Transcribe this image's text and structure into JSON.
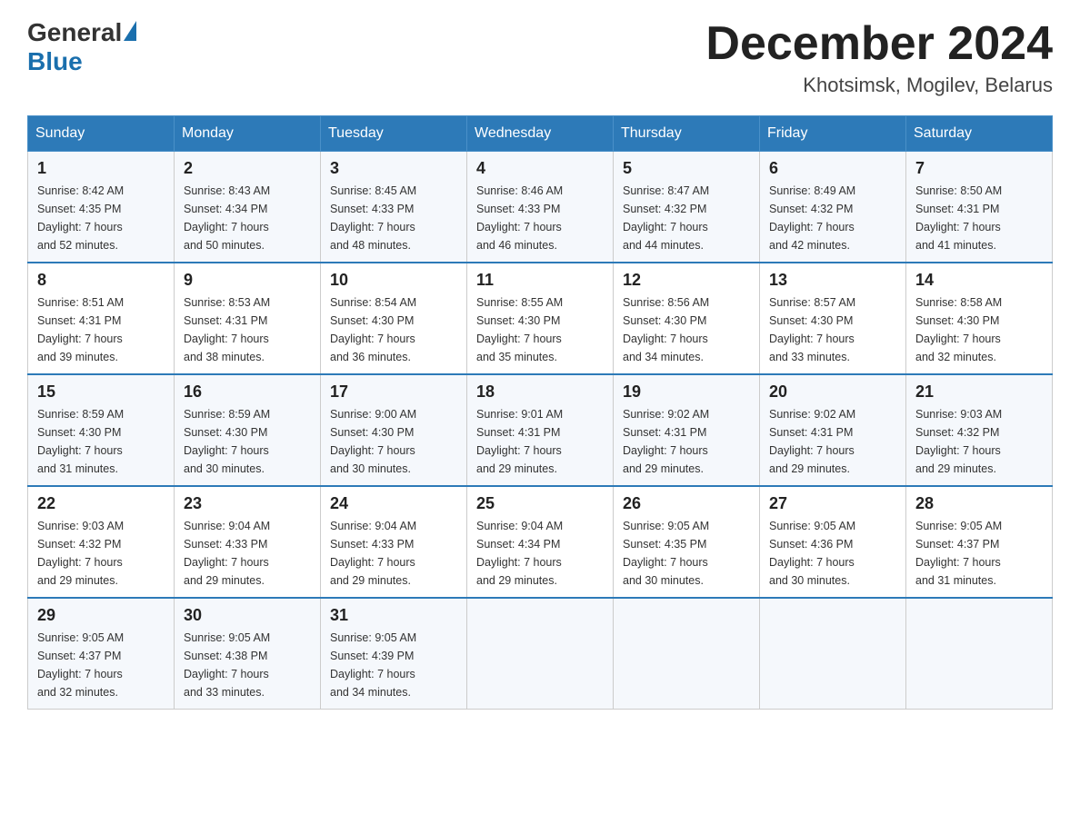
{
  "header": {
    "logo_general": "General",
    "logo_blue": "Blue",
    "month_title": "December 2024",
    "location": "Khotsimsk, Mogilev, Belarus"
  },
  "weekdays": [
    "Sunday",
    "Monday",
    "Tuesday",
    "Wednesday",
    "Thursday",
    "Friday",
    "Saturday"
  ],
  "weeks": [
    [
      {
        "day": "1",
        "info": "Sunrise: 8:42 AM\nSunset: 4:35 PM\nDaylight: 7 hours\nand 52 minutes."
      },
      {
        "day": "2",
        "info": "Sunrise: 8:43 AM\nSunset: 4:34 PM\nDaylight: 7 hours\nand 50 minutes."
      },
      {
        "day": "3",
        "info": "Sunrise: 8:45 AM\nSunset: 4:33 PM\nDaylight: 7 hours\nand 48 minutes."
      },
      {
        "day": "4",
        "info": "Sunrise: 8:46 AM\nSunset: 4:33 PM\nDaylight: 7 hours\nand 46 minutes."
      },
      {
        "day": "5",
        "info": "Sunrise: 8:47 AM\nSunset: 4:32 PM\nDaylight: 7 hours\nand 44 minutes."
      },
      {
        "day": "6",
        "info": "Sunrise: 8:49 AM\nSunset: 4:32 PM\nDaylight: 7 hours\nand 42 minutes."
      },
      {
        "day": "7",
        "info": "Sunrise: 8:50 AM\nSunset: 4:31 PM\nDaylight: 7 hours\nand 41 minutes."
      }
    ],
    [
      {
        "day": "8",
        "info": "Sunrise: 8:51 AM\nSunset: 4:31 PM\nDaylight: 7 hours\nand 39 minutes."
      },
      {
        "day": "9",
        "info": "Sunrise: 8:53 AM\nSunset: 4:31 PM\nDaylight: 7 hours\nand 38 minutes."
      },
      {
        "day": "10",
        "info": "Sunrise: 8:54 AM\nSunset: 4:30 PM\nDaylight: 7 hours\nand 36 minutes."
      },
      {
        "day": "11",
        "info": "Sunrise: 8:55 AM\nSunset: 4:30 PM\nDaylight: 7 hours\nand 35 minutes."
      },
      {
        "day": "12",
        "info": "Sunrise: 8:56 AM\nSunset: 4:30 PM\nDaylight: 7 hours\nand 34 minutes."
      },
      {
        "day": "13",
        "info": "Sunrise: 8:57 AM\nSunset: 4:30 PM\nDaylight: 7 hours\nand 33 minutes."
      },
      {
        "day": "14",
        "info": "Sunrise: 8:58 AM\nSunset: 4:30 PM\nDaylight: 7 hours\nand 32 minutes."
      }
    ],
    [
      {
        "day": "15",
        "info": "Sunrise: 8:59 AM\nSunset: 4:30 PM\nDaylight: 7 hours\nand 31 minutes."
      },
      {
        "day": "16",
        "info": "Sunrise: 8:59 AM\nSunset: 4:30 PM\nDaylight: 7 hours\nand 30 minutes."
      },
      {
        "day": "17",
        "info": "Sunrise: 9:00 AM\nSunset: 4:30 PM\nDaylight: 7 hours\nand 30 minutes."
      },
      {
        "day": "18",
        "info": "Sunrise: 9:01 AM\nSunset: 4:31 PM\nDaylight: 7 hours\nand 29 minutes."
      },
      {
        "day": "19",
        "info": "Sunrise: 9:02 AM\nSunset: 4:31 PM\nDaylight: 7 hours\nand 29 minutes."
      },
      {
        "day": "20",
        "info": "Sunrise: 9:02 AM\nSunset: 4:31 PM\nDaylight: 7 hours\nand 29 minutes."
      },
      {
        "day": "21",
        "info": "Sunrise: 9:03 AM\nSunset: 4:32 PM\nDaylight: 7 hours\nand 29 minutes."
      }
    ],
    [
      {
        "day": "22",
        "info": "Sunrise: 9:03 AM\nSunset: 4:32 PM\nDaylight: 7 hours\nand 29 minutes."
      },
      {
        "day": "23",
        "info": "Sunrise: 9:04 AM\nSunset: 4:33 PM\nDaylight: 7 hours\nand 29 minutes."
      },
      {
        "day": "24",
        "info": "Sunrise: 9:04 AM\nSunset: 4:33 PM\nDaylight: 7 hours\nand 29 minutes."
      },
      {
        "day": "25",
        "info": "Sunrise: 9:04 AM\nSunset: 4:34 PM\nDaylight: 7 hours\nand 29 minutes."
      },
      {
        "day": "26",
        "info": "Sunrise: 9:05 AM\nSunset: 4:35 PM\nDaylight: 7 hours\nand 30 minutes."
      },
      {
        "day": "27",
        "info": "Sunrise: 9:05 AM\nSunset: 4:36 PM\nDaylight: 7 hours\nand 30 minutes."
      },
      {
        "day": "28",
        "info": "Sunrise: 9:05 AM\nSunset: 4:37 PM\nDaylight: 7 hours\nand 31 minutes."
      }
    ],
    [
      {
        "day": "29",
        "info": "Sunrise: 9:05 AM\nSunset: 4:37 PM\nDaylight: 7 hours\nand 32 minutes."
      },
      {
        "day": "30",
        "info": "Sunrise: 9:05 AM\nSunset: 4:38 PM\nDaylight: 7 hours\nand 33 minutes."
      },
      {
        "day": "31",
        "info": "Sunrise: 9:05 AM\nSunset: 4:39 PM\nDaylight: 7 hours\nand 34 minutes."
      },
      null,
      null,
      null,
      null
    ]
  ]
}
